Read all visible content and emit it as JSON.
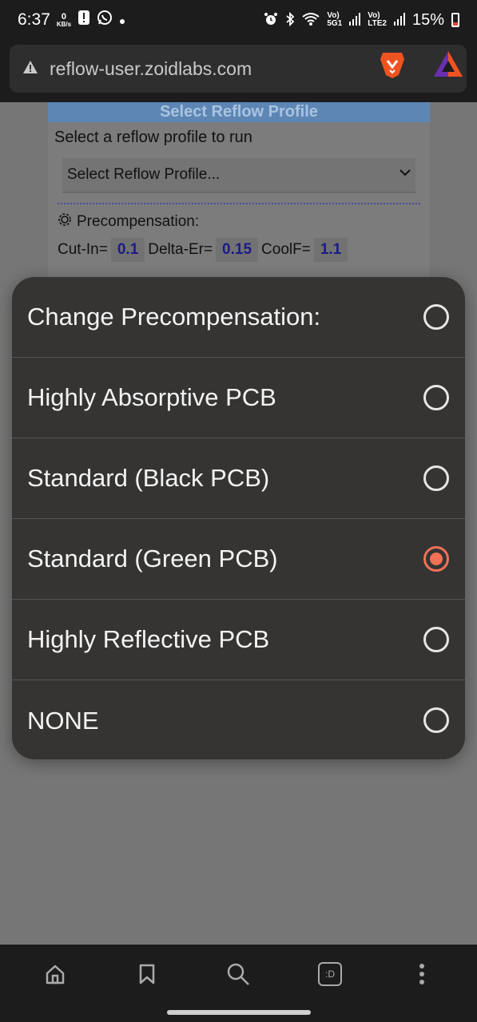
{
  "status_bar": {
    "time": "6:37",
    "net_speed_value": "0",
    "net_speed_unit": "KB/s",
    "sim1_label": "Vo)",
    "sim1_sub": "5G1",
    "sim2_label": "Vo)",
    "sim2_sub": "LTE2",
    "battery": "15%"
  },
  "browser": {
    "url": "reflow-user.zoidlabs.com"
  },
  "page": {
    "card_title": "Select Reflow Profile",
    "card_subtitle": "Select a reflow profile to run",
    "select_value": "Select Reflow Profile...",
    "precomp_label": "Precompensation:",
    "cut_in_label": "Cut-In=",
    "cut_in_value": "0.1",
    "delta_label": "Delta-Er=",
    "delta_value": "0.15",
    "coolf_label": "CoolF=",
    "coolf_value": "1.1"
  },
  "dialog": {
    "options": [
      {
        "label": "Change Precompensation:",
        "selected": false
      },
      {
        "label": "Highly Absorptive PCB",
        "selected": false
      },
      {
        "label": "Standard (Black PCB)",
        "selected": false
      },
      {
        "label": "Standard (Green PCB)",
        "selected": true
      },
      {
        "label": "Highly Reflective PCB",
        "selected": false
      },
      {
        "label": "NONE",
        "selected": false
      }
    ]
  },
  "bottom_nav": {
    "tab_badge": ":D"
  },
  "colors": {
    "accent": "#f27157",
    "dialog_bg": "#353433"
  }
}
